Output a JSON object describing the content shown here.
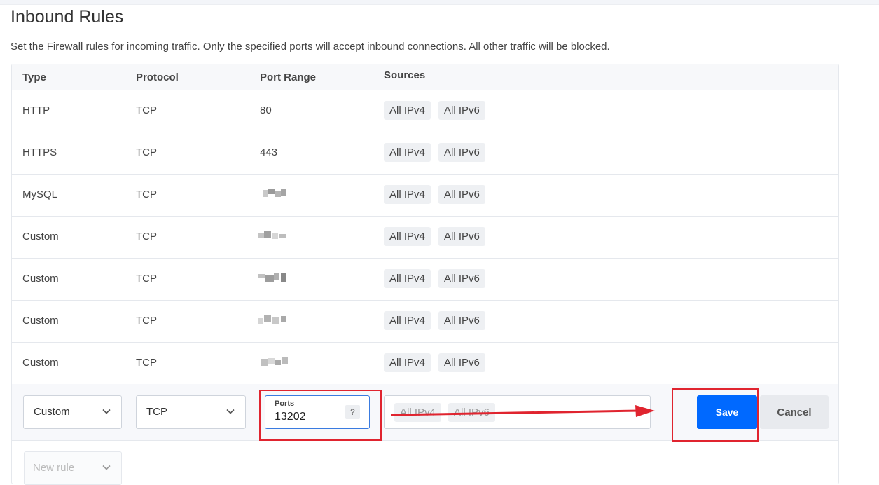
{
  "page": {
    "title": "Inbound Rules",
    "description": "Set the Firewall rules for incoming traffic. Only the specified ports will accept inbound connections. All other traffic will be blocked."
  },
  "table": {
    "headers": [
      "Type",
      "Protocol",
      "Port Range",
      "Sources"
    ],
    "rows": [
      {
        "type": "HTTP",
        "protocol": "TCP",
        "port": "80",
        "sources": [
          "All IPv4",
          "All IPv6"
        ]
      },
      {
        "type": "HTTPS",
        "protocol": "TCP",
        "port": "443",
        "sources": [
          "All IPv4",
          "All IPv6"
        ]
      },
      {
        "type": "MySQL",
        "protocol": "TCP",
        "port": "",
        "sources": [
          "All IPv4",
          "All IPv6"
        ]
      },
      {
        "type": "Custom",
        "protocol": "TCP",
        "port": "",
        "sources": [
          "All IPv4",
          "All IPv6"
        ]
      },
      {
        "type": "Custom",
        "protocol": "TCP",
        "port": "",
        "sources": [
          "All IPv4",
          "All IPv6"
        ]
      },
      {
        "type": "Custom",
        "protocol": "TCP",
        "port": "",
        "sources": [
          "All IPv4",
          "All IPv6"
        ]
      },
      {
        "type": "Custom",
        "protocol": "TCP",
        "port": "",
        "sources": [
          "All IPv4",
          "All IPv6"
        ]
      }
    ]
  },
  "edit_row": {
    "type_value": "Custom",
    "protocol_value": "TCP",
    "ports_label": "Ports",
    "ports_value": "13202",
    "ports_help": "?",
    "sources": [
      "All IPv4",
      "All IPv6"
    ],
    "save_label": "Save",
    "cancel_label": "Cancel"
  },
  "new_rule": {
    "label": "New rule"
  },
  "colors": {
    "accent": "#0069ff",
    "annotation": "#e0242f"
  }
}
